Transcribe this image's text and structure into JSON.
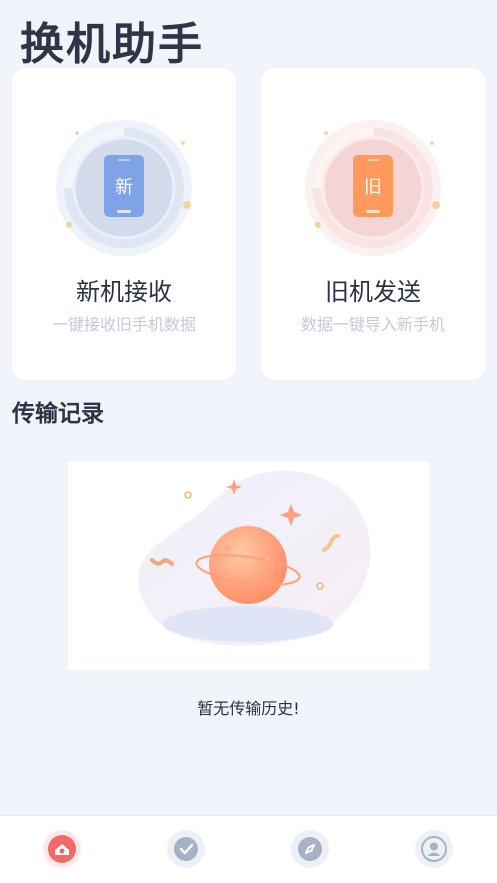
{
  "header": {
    "title": "换机助手"
  },
  "cards": [
    {
      "title": "新机接收",
      "subtitle": "一键接收旧手机数据",
      "icon_char": "新",
      "accent": "#7fa3e6"
    },
    {
      "title": "旧机发送",
      "subtitle": "数据一键导入新手机",
      "icon_char": "旧",
      "accent": "#ff9a5c"
    }
  ],
  "history": {
    "title": "传输记录",
    "empty_text": "暂无传输历史!"
  },
  "tabs": [
    {
      "icon": "home-icon",
      "active": true,
      "color": "#f06a6a"
    },
    {
      "icon": "check-icon",
      "active": false,
      "color": "#a8b2c6"
    },
    {
      "icon": "compass-icon",
      "active": false,
      "color": "#a8b2c6"
    },
    {
      "icon": "user-icon",
      "active": false,
      "color": "#a8b2c6"
    }
  ]
}
